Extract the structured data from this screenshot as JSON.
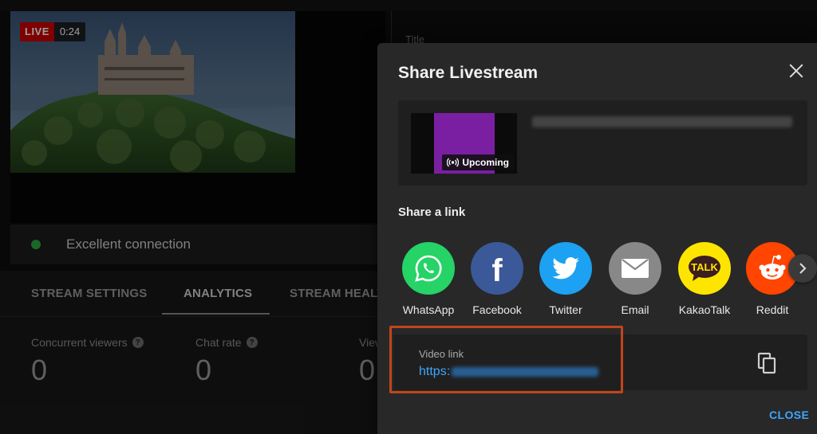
{
  "stream_preview": {
    "live_label": "LIVE",
    "elapsed": "0:24"
  },
  "details": {
    "title_label": "Title"
  },
  "connection": {
    "status_text": "Excellent connection",
    "status_color": "#2ba640"
  },
  "tabs": [
    {
      "label": "STREAM SETTINGS"
    },
    {
      "label": "ANALYTICS",
      "active": true
    },
    {
      "label": "STREAM HEALT"
    }
  ],
  "metrics": [
    {
      "label": "Concurrent viewers",
      "value": "0"
    },
    {
      "label": "Chat rate",
      "value": "0"
    },
    {
      "label": "View",
      "value": "0"
    }
  ],
  "share_modal": {
    "title": "Share Livestream",
    "stream_card": {
      "status_badge": "Upcoming",
      "thumbnail_color": "#7a1fa2"
    },
    "share_heading": "Share a link",
    "share_targets": [
      {
        "label": "WhatsApp",
        "icon": "whatsapp-icon",
        "color": "#25d366"
      },
      {
        "label": "Facebook",
        "icon": "facebook-icon",
        "color": "#3b5998"
      },
      {
        "label": "Twitter",
        "icon": "twitter-icon",
        "color": "#1da1f2"
      },
      {
        "label": "Email",
        "icon": "email-icon",
        "color": "#888888"
      },
      {
        "label": "KakaoTalk",
        "icon": "kakaotalk-icon",
        "color": "#fee500",
        "icon_text": "TALK"
      },
      {
        "label": "Reddit",
        "icon": "reddit-icon",
        "color": "#ff4500"
      }
    ],
    "video_link": {
      "label": "Video link",
      "url_prefix": "https:"
    },
    "close_label": "CLOSE",
    "highlight_color": "#c2451b",
    "accent_color": "#3ea6ff"
  }
}
